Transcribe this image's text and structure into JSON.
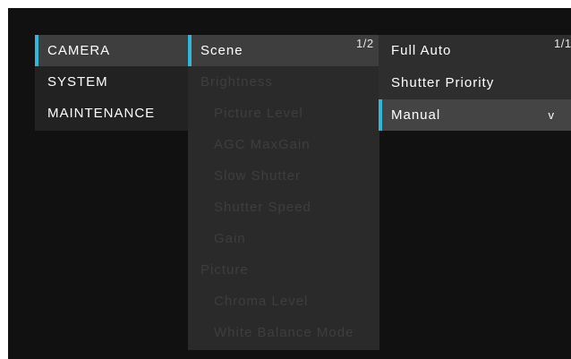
{
  "menu_main": {
    "items": [
      {
        "label": "CAMERA"
      },
      {
        "label": "SYSTEM"
      },
      {
        "label": "MAINTENANCE"
      }
    ]
  },
  "menu_camera": {
    "page_indicator": "1/2",
    "items": [
      {
        "label": "Scene"
      },
      {
        "label": "Brightness"
      },
      {
        "label": "Picture Level"
      },
      {
        "label": "AGC MaxGain"
      },
      {
        "label": "Slow Shutter"
      },
      {
        "label": "Shutter Speed"
      },
      {
        "label": "Gain"
      },
      {
        "label": "Picture"
      },
      {
        "label": "Chroma Level"
      },
      {
        "label": "White Balance Mode"
      }
    ]
  },
  "menu_scene": {
    "page_indicator": "1/1",
    "items": [
      {
        "label": "Full Auto"
      },
      {
        "label": "Shutter Priority"
      },
      {
        "label": "Manual"
      }
    ],
    "selected_arrow": "v"
  },
  "colors": {
    "accent": "#33b7d9",
    "background": "#111111",
    "text": "#ffffff",
    "disabled_text": "#3e3e3e"
  }
}
